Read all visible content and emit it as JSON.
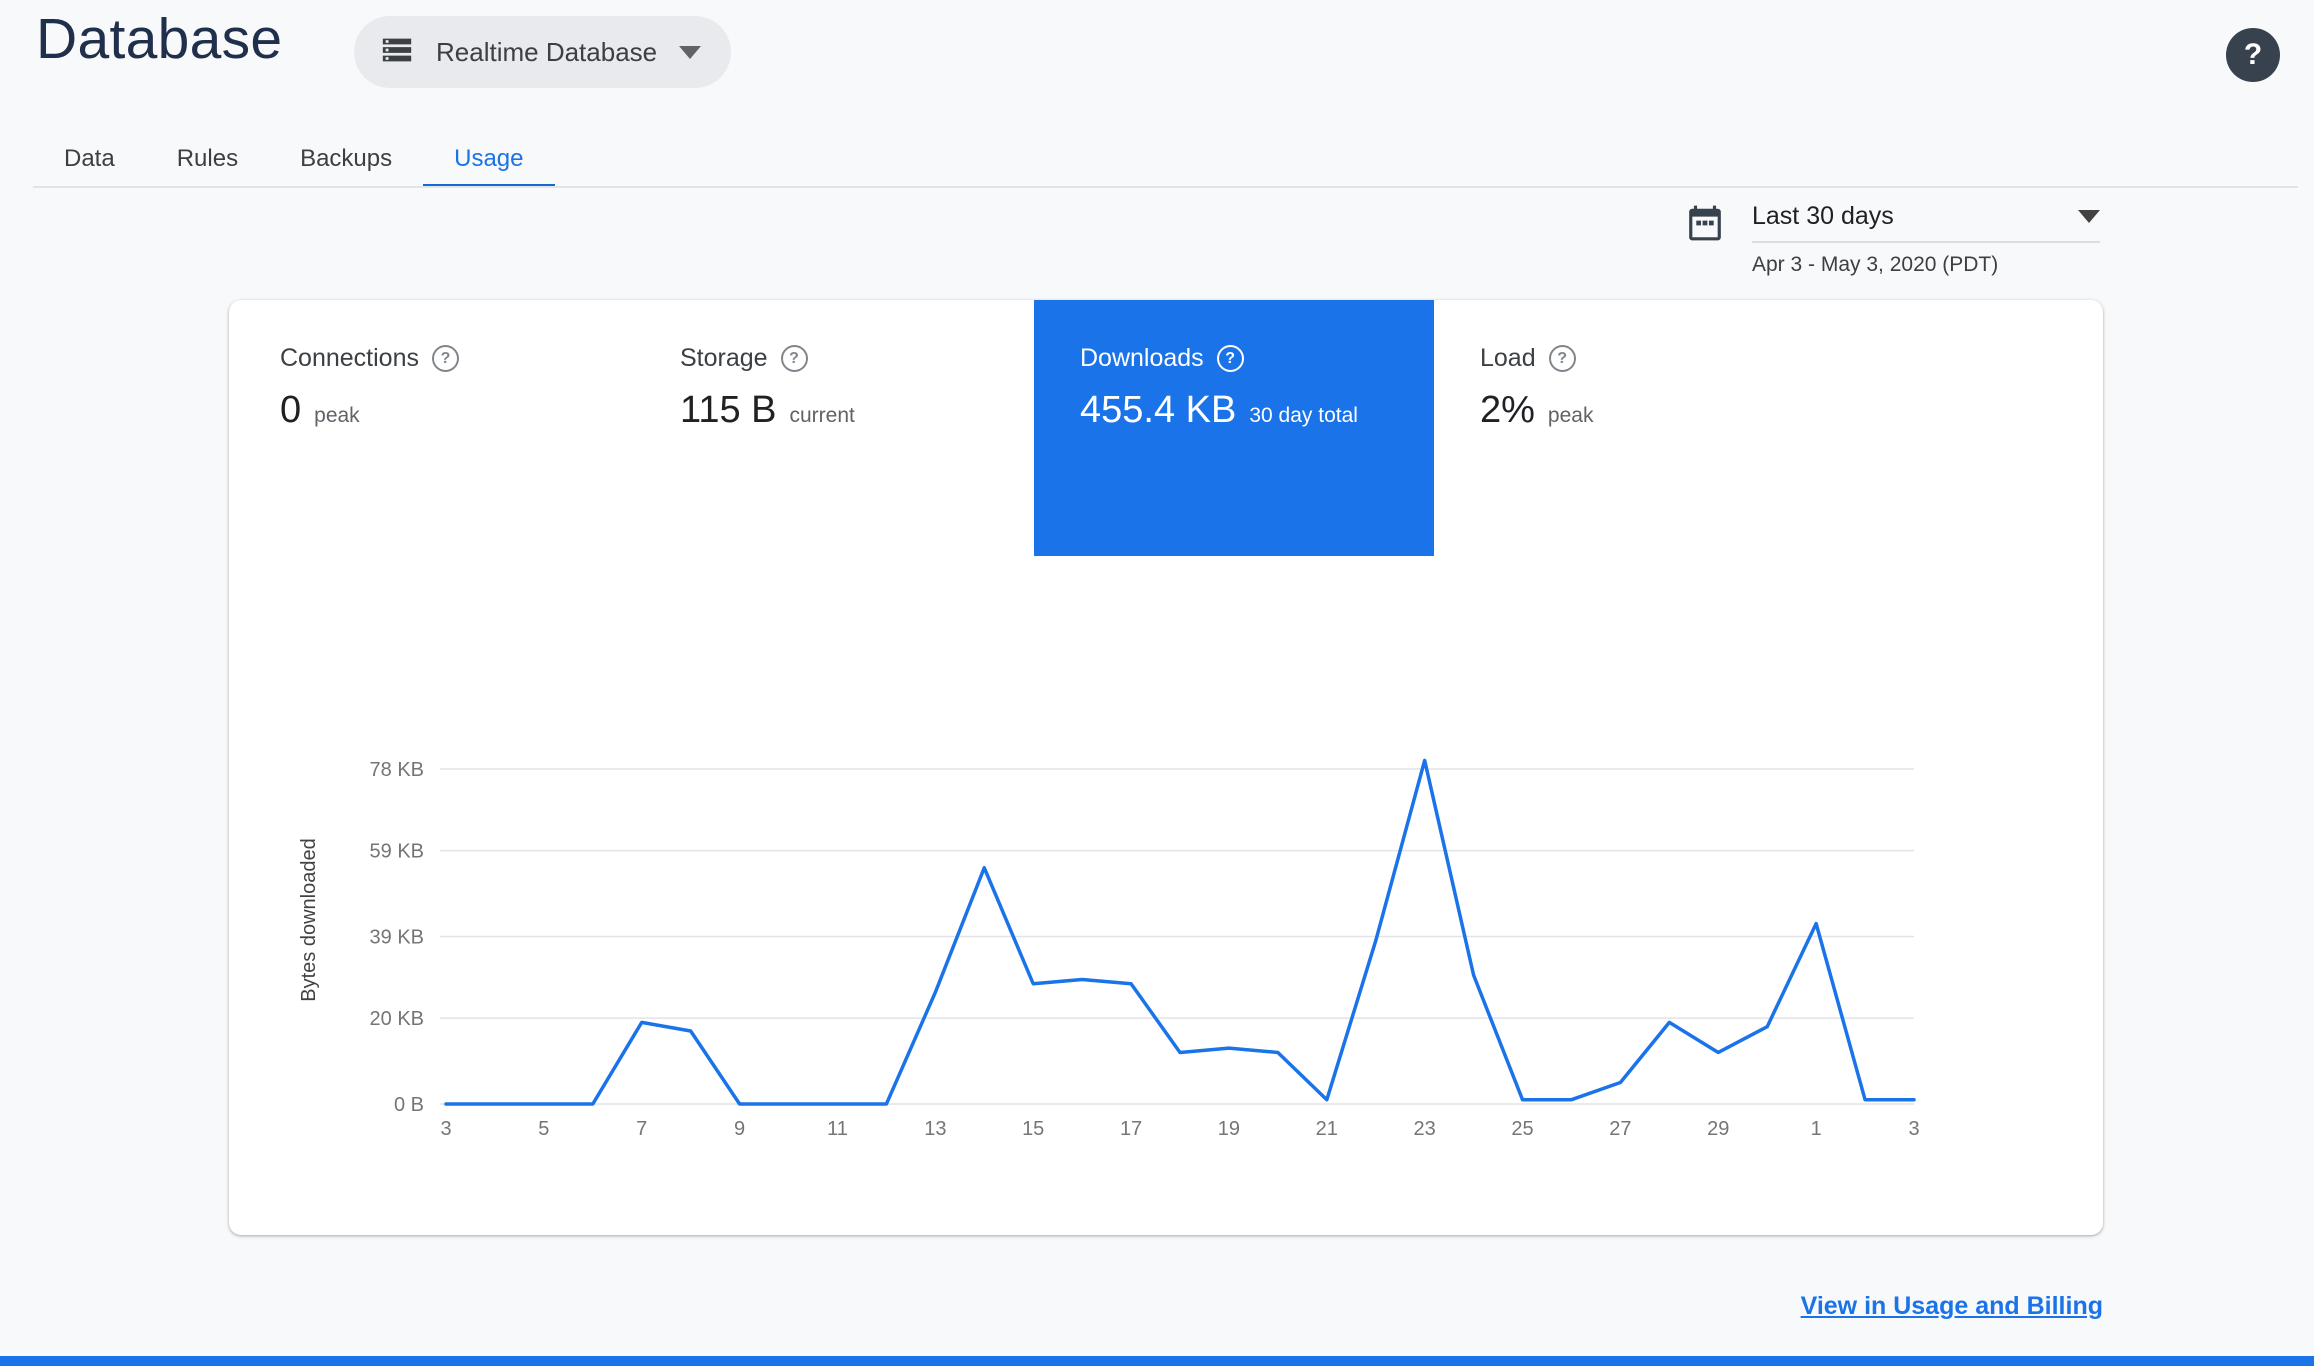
{
  "icons": {
    "question_mark": "?"
  },
  "header": {
    "title": "Database",
    "database_selector_label": "Realtime Database"
  },
  "tabs": [
    {
      "label": "Data"
    },
    {
      "label": "Rules"
    },
    {
      "label": "Backups"
    },
    {
      "label": "Usage"
    }
  ],
  "date_range": {
    "label": "Last 30 days",
    "detail": "Apr 3 - May 3, 2020 (PDT)"
  },
  "metrics": [
    {
      "label": "Connections",
      "value": "0",
      "unit": "peak"
    },
    {
      "label": "Storage",
      "value": "115 B",
      "unit": "current"
    },
    {
      "label": "Downloads",
      "value": "455.4 KB",
      "unit": "30 day total"
    },
    {
      "label": "Load",
      "value": "2%",
      "unit": "peak"
    }
  ],
  "footer": {
    "link_label": "View in Usage and Billing"
  },
  "colors": {
    "accent": "#1a73e8",
    "selected_tile_bg": "#1a73e8",
    "bottom_bar": "#1a73e8"
  },
  "chart_data": {
    "type": "line",
    "ylabel": "Bytes downloaded",
    "x_days": [
      3,
      4,
      5,
      6,
      7,
      8,
      9,
      10,
      11,
      12,
      13,
      14,
      15,
      16,
      17,
      18,
      19,
      20,
      21,
      22,
      23,
      24,
      25,
      26,
      27,
      28,
      29,
      30,
      1,
      2,
      3
    ],
    "x_tick_labels": [
      "3",
      "5",
      "7",
      "9",
      "11",
      "13",
      "15",
      "17",
      "19",
      "21",
      "23",
      "25",
      "27",
      "29",
      "1",
      "3"
    ],
    "values_kb": [
      0,
      0,
      0,
      0,
      19,
      17,
      0,
      0,
      0,
      0,
      26,
      55,
      28,
      29,
      28,
      12,
      13,
      12,
      1,
      38,
      80,
      30,
      1,
      1,
      5,
      19,
      12,
      18,
      42,
      1,
      1
    ],
    "y_ticks": [
      {
        "value": 0,
        "label": "0 B"
      },
      {
        "value": 20,
        "label": "20 KB"
      },
      {
        "value": 39,
        "label": "39 KB"
      },
      {
        "value": 59,
        "label": "59 KB"
      },
      {
        "value": 78,
        "label": "78 KB"
      }
    ],
    "ylim": [
      0,
      88
    ],
    "series_color": "#1a73e8",
    "grid": "horizontal-only",
    "legend": "none"
  }
}
